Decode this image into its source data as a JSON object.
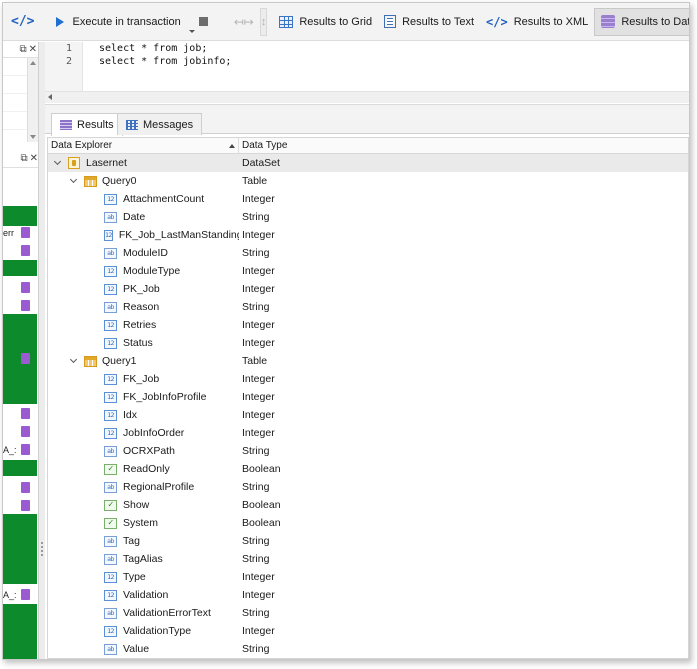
{
  "toolbar": {
    "code_icon_glyph": "</>",
    "execute_label": "Execute in transaction",
    "results_to_grid": "Results to Grid",
    "results_to_text": "Results to Text",
    "results_to_xml": "Results to XML",
    "results_to_dataset": "Results to DataSet"
  },
  "left_panel": {
    "labels": [
      "err",
      "A_:",
      "A_:"
    ]
  },
  "editor": {
    "lines": [
      {
        "num": "1",
        "code": "select * from job;"
      },
      {
        "num": "2",
        "code": "select * from jobinfo;"
      }
    ]
  },
  "tabs": {
    "results": "Results",
    "messages": "Messages"
  },
  "grid": {
    "col_explorer": "Data Explorer",
    "col_type": "Data Type",
    "root": {
      "name": "Lasernet",
      "type": "DataSet"
    },
    "query0": {
      "name": "Query0",
      "type": "Table"
    },
    "query0_fields": [
      {
        "icon": "integer",
        "name": "AttachmentCount",
        "type": "Integer"
      },
      {
        "icon": "string",
        "name": "Date",
        "type": "String"
      },
      {
        "icon": "integer",
        "name": "FK_Job_LastManStanding",
        "type": "Integer"
      },
      {
        "icon": "string",
        "name": "ModuleID",
        "type": "String"
      },
      {
        "icon": "integer",
        "name": "ModuleType",
        "type": "Integer"
      },
      {
        "icon": "integer",
        "name": "PK_Job",
        "type": "Integer"
      },
      {
        "icon": "string",
        "name": "Reason",
        "type": "String"
      },
      {
        "icon": "integer",
        "name": "Retries",
        "type": "Integer"
      },
      {
        "icon": "integer",
        "name": "Status",
        "type": "Integer"
      }
    ],
    "query1": {
      "name": "Query1",
      "type": "Table"
    },
    "query1_fields": [
      {
        "icon": "integer",
        "name": "FK_Job",
        "type": "Integer"
      },
      {
        "icon": "integer",
        "name": "FK_JobInfoProfile",
        "type": "Integer"
      },
      {
        "icon": "integer",
        "name": "Idx",
        "type": "Integer"
      },
      {
        "icon": "integer",
        "name": "JobInfoOrder",
        "type": "Integer"
      },
      {
        "icon": "string",
        "name": "OCRXPath",
        "type": "String"
      },
      {
        "icon": "boolean",
        "name": "ReadOnly",
        "type": "Boolean"
      },
      {
        "icon": "string",
        "name": "RegionalProfile",
        "type": "String"
      },
      {
        "icon": "boolean",
        "name": "Show",
        "type": "Boolean"
      },
      {
        "icon": "boolean",
        "name": "System",
        "type": "Boolean"
      },
      {
        "icon": "string",
        "name": "Tag",
        "type": "String"
      },
      {
        "icon": "string",
        "name": "TagAlias",
        "type": "String"
      },
      {
        "icon": "integer",
        "name": "Type",
        "type": "Integer"
      },
      {
        "icon": "integer",
        "name": "Validation",
        "type": "Integer"
      },
      {
        "icon": "string",
        "name": "ValidationErrorText",
        "type": "String"
      },
      {
        "icon": "integer",
        "name": "ValidationType",
        "type": "Integer"
      },
      {
        "icon": "string",
        "name": "Value",
        "type": "String"
      }
    ],
    "type_icon_glyphs": {
      "integer": "12",
      "string": "ab",
      "boolean": "✓"
    }
  }
}
